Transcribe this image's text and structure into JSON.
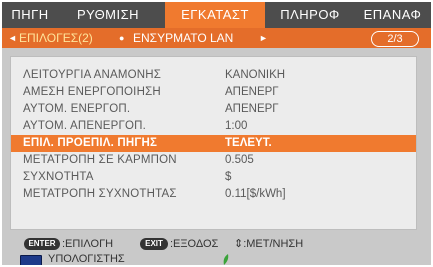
{
  "tabs": [
    "ΠΗΓΗ",
    "ΡΥΘΜΙΣΗ",
    "ΕΓΚΑΤΑΣΤ",
    "ΠΛΗΡΟΦ",
    "ΕΠΑΝΑΦ"
  ],
  "subbar": {
    "left_arrow": "◄",
    "current": "ΕΠΙΛΟΓΕΣ(2)",
    "separator": "●",
    "next": "ΕΝΣΥΡΜΑΤΟ LAN",
    "right_arrow": "►",
    "page": "2/3"
  },
  "settings": [
    {
      "label": "ΛΕΙΤΟΥΡΓΙΑ ΑΝΑΜΟΝΗΣ",
      "value": "ΚΑΝΟΝΙΚΗ"
    },
    {
      "label": "ΑΜΕΣΗ ΕΝΕΡΓΟΠΟΙΗΣΗ",
      "value": "ΑΠΕΝΕΡΓ"
    },
    {
      "label": "ΑΥΤΟΜ. ΕΝΕΡΓΟΠ.",
      "value": "ΑΠΕΝΕΡΓ"
    },
    {
      "label": "ΑΥΤΟΜ. ΑΠΕΝΕΡΓΟΠ.",
      "value": "1:00"
    },
    {
      "label": "ΕΠΙΛ. ΠΡΟΕΠΙΛ. ΠΗΓΗΣ",
      "value": "ΤΕΛΕΥΤ."
    },
    {
      "label": "ΜΕΤΑΤΡΟΠΗ ΣΕ ΚΑΡΜΠΟΝ",
      "value": "0.505"
    },
    {
      "label": "ΣΥΧΝΟΤΗΤΑ",
      "value": "$"
    },
    {
      "label": "ΜΕΤΑΤΡΟΠΗ ΣΥΧΝΟΤΗΤΑΣ",
      "value": "0.11[$/kWh]"
    }
  ],
  "selected_index": 4,
  "status": {
    "enter_key": "ENTER",
    "enter_text": ":ΕΠΙΛΟΓΗ",
    "exit_key": "EXIT",
    "exit_text": ":ΕΞΟΔΟΣ",
    "move_text": "⇕:ΜΕΤ/ΝΗΣΗ"
  },
  "source": {
    "icon": "computer-monitor-icon",
    "label": "ΥΠΟΛΟΓΙΣΤΗΣ"
  },
  "colors": {
    "accent": "#f07a2f",
    "subbar": "#e46d2a",
    "tab_bar": "#4d4d4d",
    "panel": "#ececec",
    "frame": "#c9c9c9"
  }
}
